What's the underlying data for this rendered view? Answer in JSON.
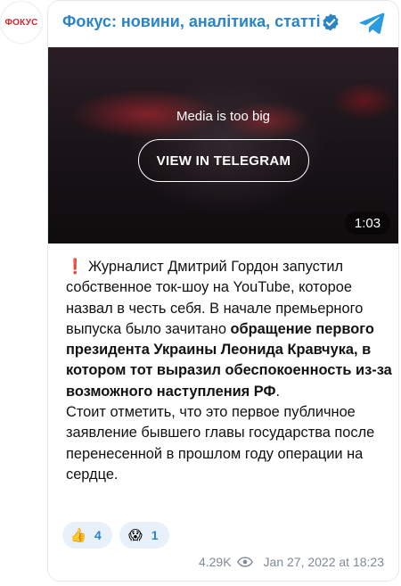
{
  "channel": {
    "avatar_text": "ФОКУС",
    "name": "Фокус: новини, аналітика, статті",
    "verified_icon": "verified-check-icon",
    "telegram_icon": "telegram-plane-icon",
    "accent_color": "#2b84c5"
  },
  "media": {
    "message": "Media is too big",
    "button_label": "VIEW IN TELEGRAM",
    "duration": "1:03"
  },
  "post": {
    "excl": "❗️",
    "p1": " Журналист Дмитрий Гордон запустил собственное ток-шоу на YouTube, которое назвал в честь себя. В начале премьерного выпуска было зачитано ",
    "bold": "обращение первого президента Украины Леонида Кравчука, в котором тот выразил обеспокоенность из-за возможного наступления РФ",
    "p2": ".",
    "p3": "Стоит отметить, что это первое публичное заявление бывшего главы государства после перенесенной в прошлом году операции на сердце."
  },
  "reactions": [
    {
      "emoji": "👍",
      "count": "4"
    },
    {
      "emoji": "😱",
      "count": "1"
    }
  ],
  "footer": {
    "views": "4.29K",
    "date": "Jan 27, 2022 at 18:23",
    "eye_icon": "eye-icon"
  }
}
